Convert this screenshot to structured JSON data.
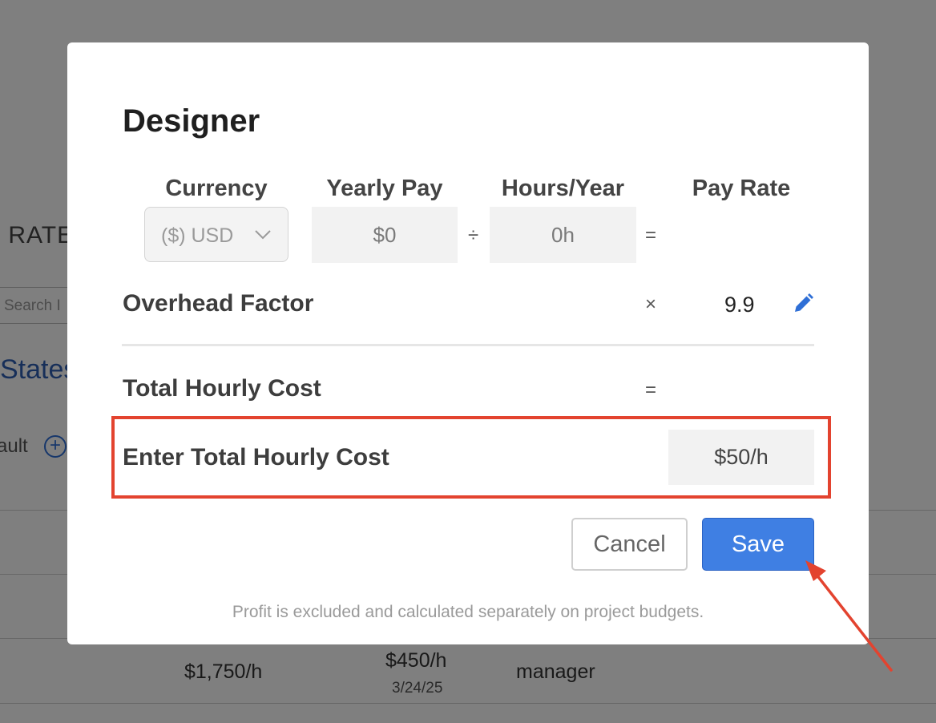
{
  "background": {
    "page_title_fragment": "K RATES",
    "search_placeholder_fragment": "Search I",
    "states_fragment": "States",
    "default_fragment": "ault",
    "add_icon": "plus-circle-icon",
    "row": {
      "rate": "$1,750/h",
      "cost": "$450/h",
      "date": "3/24/25",
      "role": "manager"
    }
  },
  "modal": {
    "title": "Designer",
    "columns": {
      "currency": "Currency",
      "yearly_pay": "Yearly Pay",
      "hours_year": "Hours/Year",
      "pay_rate": "Pay Rate"
    },
    "currency_value": "($) USD",
    "yearly_pay_value": "$0",
    "divide_symbol": "÷",
    "hours_value": "0h",
    "equals_symbol": "=",
    "overhead": {
      "label": "Overhead Factor",
      "times_symbol": "×",
      "value": "9.9",
      "edit_icon": "pencil-icon"
    },
    "total": {
      "label": "Total Hourly Cost",
      "equals_symbol": "="
    },
    "enter_total": {
      "label": "Enter Total Hourly Cost",
      "value": "$50/h"
    },
    "buttons": {
      "cancel": "Cancel",
      "save": "Save"
    },
    "footnote": "Profit is excluded and calculated separately on project budgets."
  },
  "colors": {
    "highlight_box": "#e3432f",
    "annotation_arrow": "#e3432f",
    "save_button": "#3f7fe3",
    "edit_icon": "#2f6fd6"
  }
}
